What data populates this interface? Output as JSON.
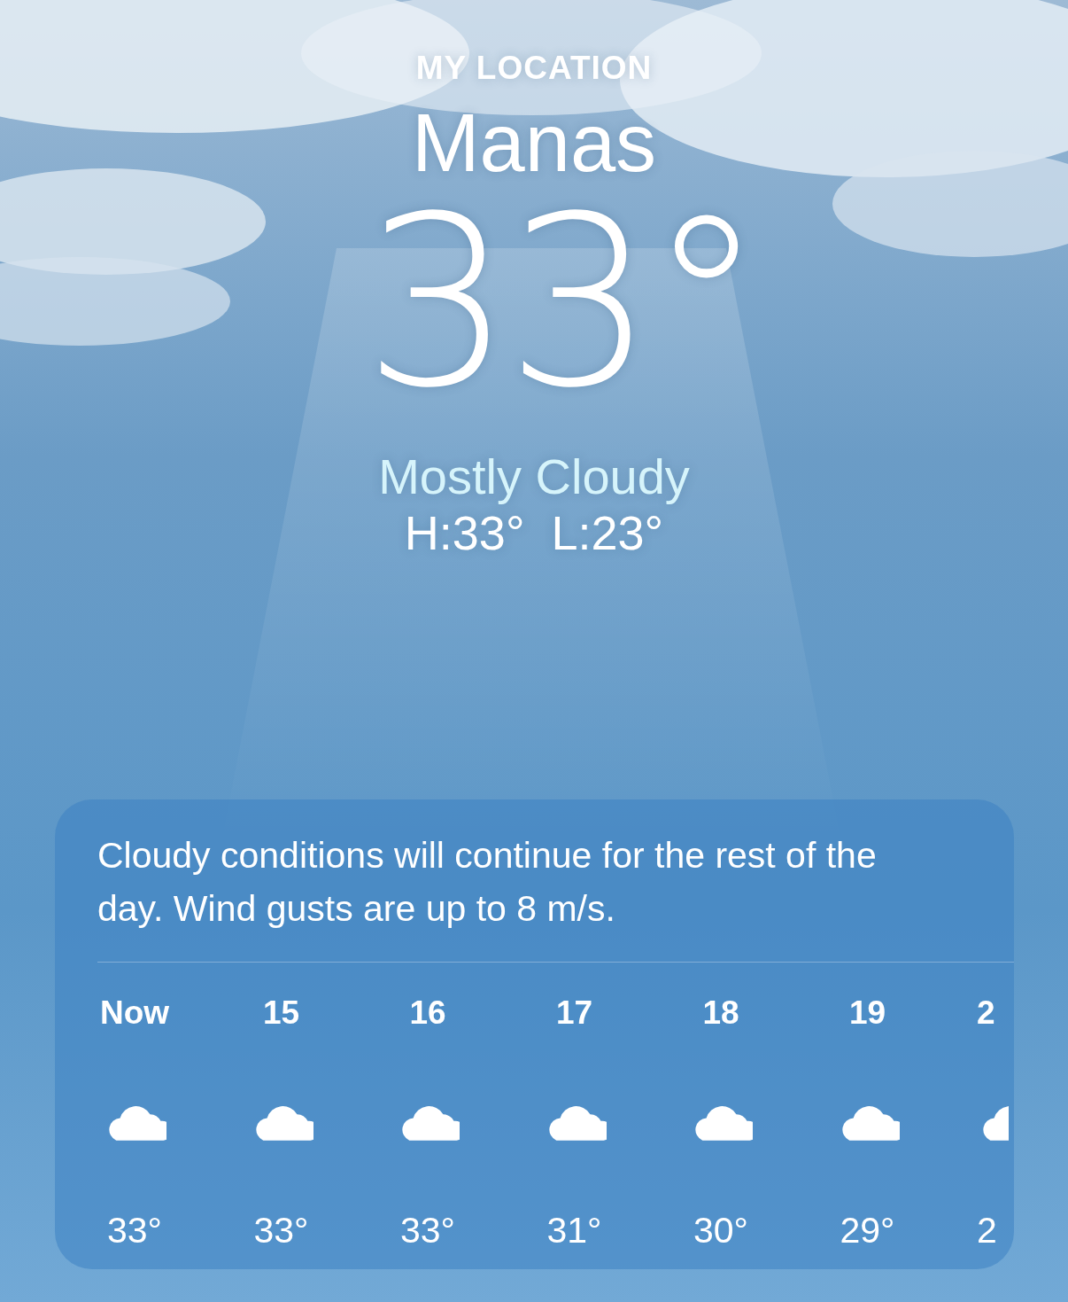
{
  "location_label": "MY LOCATION",
  "city": "Manas",
  "temperature": "33°",
  "condition": "Mostly Cloudy",
  "high": "H:33°",
  "low": "L:23°",
  "forecast": {
    "summary": "Cloudy conditions will continue for the rest of the day. Wind gusts are up to 8 m/s.",
    "hours": [
      {
        "time": "Now",
        "temp": "33°"
      },
      {
        "time": "15",
        "temp": "33°"
      },
      {
        "time": "16",
        "temp": "33°"
      },
      {
        "time": "17",
        "temp": "31°"
      },
      {
        "time": "18",
        "temp": "30°"
      },
      {
        "time": "19",
        "temp": "29°"
      },
      {
        "time": "2",
        "temp": "2"
      }
    ]
  }
}
